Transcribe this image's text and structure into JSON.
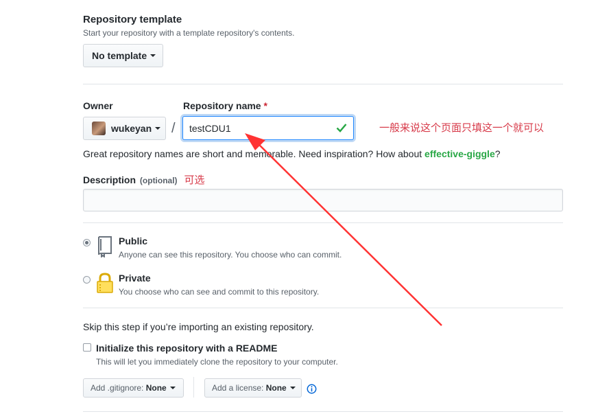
{
  "template": {
    "title": "Repository template",
    "subtitle": "Start your repository with a template repository's contents.",
    "button": "No template"
  },
  "owner": {
    "label": "Owner",
    "name": "wukeyan"
  },
  "repo": {
    "label": "Repository name",
    "required_mark": "*",
    "separator": "/",
    "value": "testCDU1"
  },
  "annotation_main": "一般来说这个页面只填这一个就可以",
  "hint": {
    "prefix": "Great repository names are short and memorable. Need inspiration? How about ",
    "suggestion": "effective-giggle",
    "suffix": "?"
  },
  "description": {
    "label": "Description",
    "optional": "(optional)",
    "annotation": "可选",
    "value": ""
  },
  "visibility": {
    "public": {
      "title": "Public",
      "desc": "Anyone can see this repository. You choose who can commit.",
      "checked": true
    },
    "private": {
      "title": "Private",
      "desc": "You choose who can see and commit to this repository.",
      "checked": false
    }
  },
  "import_note": "Skip this step if you’re importing an existing repository.",
  "readme": {
    "label": "Initialize this repository with a README",
    "desc": "This will let you immediately clone the repository to your computer."
  },
  "gitignore": {
    "prefix": "Add .gitignore: ",
    "value": "None"
  },
  "license": {
    "prefix": "Add a license: ",
    "value": "None"
  },
  "colors": {
    "accent": "#0366d6",
    "success": "#28a745",
    "annotation": "#d73a49",
    "arrow": "#ff3333"
  },
  "icons": [
    "caret-down-icon",
    "check-icon",
    "repo-book-icon",
    "lock-icon",
    "info-icon",
    "avatar"
  ]
}
